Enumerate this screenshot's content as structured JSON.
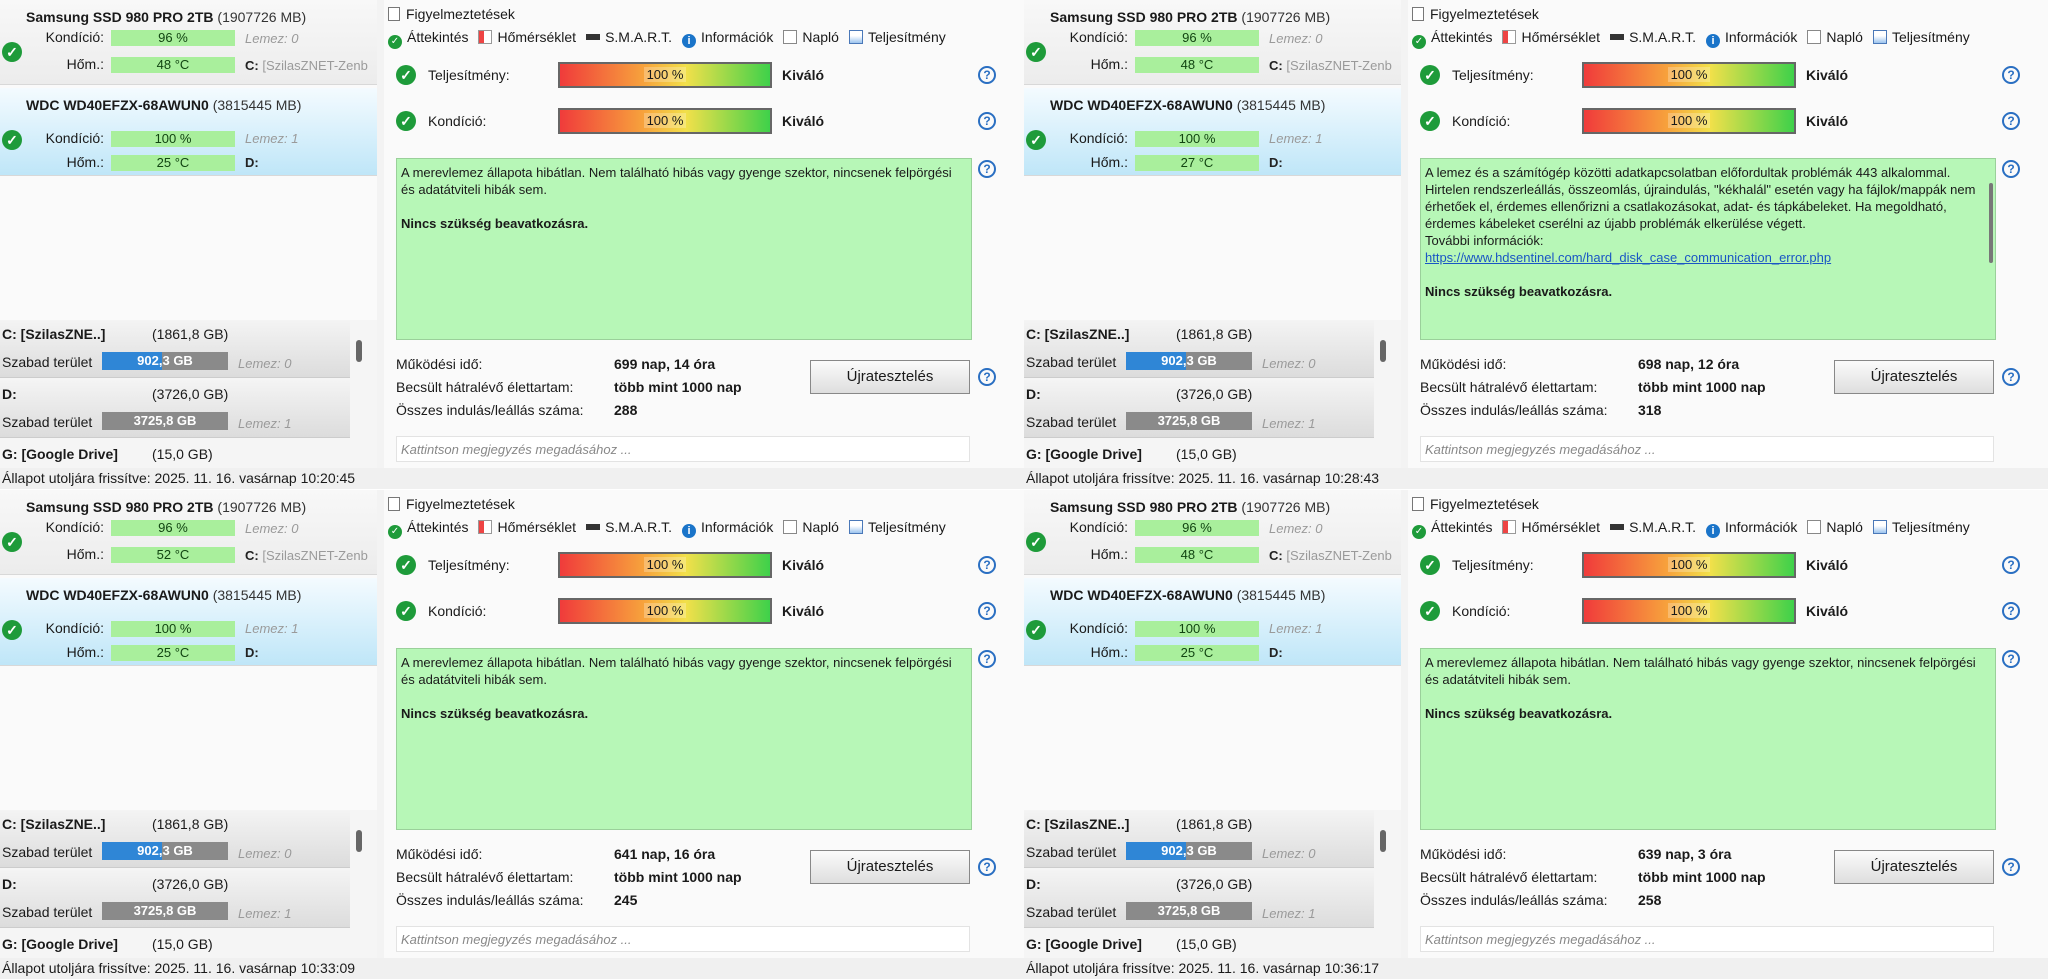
{
  "icon_names": {
    "ok": "check-circle-icon",
    "temp": "thermometer-icon",
    "smart": "smart-icon",
    "info": "info-icon",
    "log": "log-icon",
    "perf": "performance-chart-icon",
    "help": "help-icon",
    "warn": "document-icon"
  },
  "colors": {
    "health_bar": "#a9ef9c",
    "selected_disk": "#bfe6f8",
    "message_bg": "#b7f7b7",
    "free_bar": "#2f86d6",
    "ok": "#1e9b3a"
  },
  "panes": [
    {
      "disks": [
        {
          "name": "Samsung SSD 980 PRO 2TB",
          "size": "(1907726 MB)",
          "health_label": "Kondíció:",
          "health": "96 %",
          "temp_label": "Hőm.:",
          "temp": "48 °C",
          "lemez": "Lemez: 0",
          "drive_letter": "C:",
          "drive_name": "[SzilasZNET-Zenb"
        },
        {
          "name": "WDC WD40EFZX-68AWUN0",
          "size": "(3815445 MB)",
          "health_label": "Kondíció:",
          "health": "100 %",
          "temp_label": "Hőm.:",
          "temp": "25 °C",
          "lemez": "Lemez: 1",
          "drive_letter": "D:",
          "drive_name": ""
        }
      ],
      "volumes": [
        {
          "title": "C: [SzilasZNE..]",
          "size": "(1861,8 GB)",
          "free_label": "Szabad terület",
          "free": "902,3 GB",
          "free_fraction": 0.48,
          "lemez": "Lemez: 0"
        },
        {
          "title": "D:",
          "size": "(3726,0 GB)",
          "free_label": "Szabad terület",
          "free": "3725,8 GB",
          "free_fraction": 0.0,
          "lemez": "Lemez: 1"
        },
        {
          "title": "G: [Google Drive]",
          "size": "(15,0 GB)"
        }
      ],
      "warnings": "Figyelmeztetések",
      "tabs": [
        "Áttekintés",
        "Hőmérséklet",
        "S.M.A.R.T.",
        "Információk",
        "Napló",
        "Teljesítmény"
      ],
      "perf_label": "Teljesítmény:",
      "perf_value": "100 %",
      "perf_rating": "Kiváló",
      "health_label": "Kondíció:",
      "health_value": "100 %",
      "health_rating": "Kiváló",
      "message_lines": [
        "A merevlemez állapota hibátlan. Nem található hibás vagy gyenge szektor, nincsenek felpörgési és adatátviteli hibák sem."
      ],
      "message_link": "",
      "message_bold": "Nincs szükség beavatkozásra.",
      "uptime_label": "Működési idő:",
      "uptime": "699 nap, 14 óra",
      "life_label": "Becsült hátralévő élettartam:",
      "life": "több mint 1000 nap",
      "starts_label": "Összes indulás/leállás száma:",
      "starts": "288",
      "retest": "Újratesztelés",
      "note_placeholder": "Kattintson megjegyzés megadásához ...",
      "status": "Állapot utoljára frissítve: 2025. 11. 16. vasárnap 10:20:45"
    },
    {
      "disks": [
        {
          "name": "Samsung SSD 980 PRO 2TB",
          "size": "(1907726 MB)",
          "health_label": "Kondíció:",
          "health": "96 %",
          "temp_label": "Hőm.:",
          "temp": "48 °C",
          "lemez": "Lemez: 0",
          "drive_letter": "C:",
          "drive_name": "[SzilasZNET-Zenb"
        },
        {
          "name": "WDC WD40EFZX-68AWUN0",
          "size": "(3815445 MB)",
          "health_label": "Kondíció:",
          "health": "100 %",
          "temp_label": "Hőm.:",
          "temp": "27 °C",
          "lemez": "Lemez: 1",
          "drive_letter": "D:",
          "drive_name": ""
        }
      ],
      "volumes": [
        {
          "title": "C: [SzilasZNE..]",
          "size": "(1861,8 GB)",
          "free_label": "Szabad terület",
          "free": "902,3 GB",
          "free_fraction": 0.48,
          "lemez": "Lemez: 0"
        },
        {
          "title": "D:",
          "size": "(3726,0 GB)",
          "free_label": "Szabad terület",
          "free": "3725,8 GB",
          "free_fraction": 0.0,
          "lemez": "Lemez: 1"
        },
        {
          "title": "G: [Google Drive]",
          "size": "(15,0 GB)"
        }
      ],
      "warnings": "Figyelmeztetések",
      "tabs": [
        "Áttekintés",
        "Hőmérséklet",
        "S.M.A.R.T.",
        "Információk",
        "Napló",
        "Teljesítmény"
      ],
      "perf_label": "Teljesítmény:",
      "perf_value": "100 %",
      "perf_rating": "Kiváló",
      "health_label": "Kondíció:",
      "health_value": "100 %",
      "health_rating": "Kiváló",
      "message_lines": [
        "A lemez és a számítógép közötti adatkapcsolatban előfordultak problémák 443 alkalommal.",
        "Hirtelen rendszerleállás, összeomlás, újraindulás, \"kékhalál\" esetén vagy ha fájlok/mappák nem érhetőek el, érdemes ellenőrizni a csatlakozásokat, adat- és tápkábeleket. Ha megoldható, érdemes kábeleket cserélni az újabb problémák elkerülése végett.",
        "További információk:"
      ],
      "message_link": "https://www.hdsentinel.com/hard_disk_case_communication_error.php",
      "message_bold": "Nincs szükség beavatkozásra.",
      "uptime_label": "Működési idő:",
      "uptime": "698 nap, 12 óra",
      "life_label": "Becsült hátralévő élettartam:",
      "life": "több mint 1000 nap",
      "starts_label": "Összes indulás/leállás száma:",
      "starts": "318",
      "retest": "Újratesztelés",
      "note_placeholder": "Kattintson megjegyzés megadásához ...",
      "status": "Állapot utoljára frissítve: 2025. 11. 16. vasárnap 10:28:43"
    },
    {
      "disks": [
        {
          "name": "Samsung SSD 980 PRO 2TB",
          "size": "(1907726 MB)",
          "health_label": "Kondíció:",
          "health": "96 %",
          "temp_label": "Hőm.:",
          "temp": "52 °C",
          "lemez": "Lemez: 0",
          "drive_letter": "C:",
          "drive_name": "[SzilasZNET-Zenb"
        },
        {
          "name": "WDC WD40EFZX-68AWUN0",
          "size": "(3815445 MB)",
          "health_label": "Kondíció:",
          "health": "100 %",
          "temp_label": "Hőm.:",
          "temp": "25 °C",
          "lemez": "Lemez: 1",
          "drive_letter": "D:",
          "drive_name": ""
        }
      ],
      "volumes": [
        {
          "title": "C: [SzilasZNE..]",
          "size": "(1861,8 GB)",
          "free_label": "Szabad terület",
          "free": "902,3 GB",
          "free_fraction": 0.48,
          "lemez": "Lemez: 0"
        },
        {
          "title": "D:",
          "size": "(3726,0 GB)",
          "free_label": "Szabad terület",
          "free": "3725,8 GB",
          "free_fraction": 0.0,
          "lemez": "Lemez: 1"
        },
        {
          "title": "G: [Google Drive]",
          "size": "(15,0 GB)"
        }
      ],
      "warnings": "Figyelmeztetések",
      "tabs": [
        "Áttekintés",
        "Hőmérséklet",
        "S.M.A.R.T.",
        "Információk",
        "Napló",
        "Teljesítmény"
      ],
      "perf_label": "Teljesítmény:",
      "perf_value": "100 %",
      "perf_rating": "Kiváló",
      "health_label": "Kondíció:",
      "health_value": "100 %",
      "health_rating": "Kiváló",
      "message_lines": [
        "A merevlemez állapota hibátlan. Nem található hibás vagy gyenge szektor, nincsenek felpörgési és adatátviteli hibák sem."
      ],
      "message_link": "",
      "message_bold": "Nincs szükség beavatkozásra.",
      "uptime_label": "Működési idő:",
      "uptime": "641 nap, 16 óra",
      "life_label": "Becsült hátralévő élettartam:",
      "life": "több mint 1000 nap",
      "starts_label": "Összes indulás/leállás száma:",
      "starts": "245",
      "retest": "Újratesztelés",
      "note_placeholder": "Kattintson megjegyzés megadásához ...",
      "status": "Állapot utoljára frissítve: 2025. 11. 16. vasárnap 10:33:09"
    },
    {
      "disks": [
        {
          "name": "Samsung SSD 980 PRO 2TB",
          "size": "(1907726 MB)",
          "health_label": "Kondíció:",
          "health": "96 %",
          "temp_label": "Hőm.:",
          "temp": "48 °C",
          "lemez": "Lemez: 0",
          "drive_letter": "C:",
          "drive_name": "[SzilasZNET-Zenb"
        },
        {
          "name": "WDC WD40EFZX-68AWUN0",
          "size": "(3815445 MB)",
          "health_label": "Kondíció:",
          "health": "100 %",
          "temp_label": "Hőm.:",
          "temp": "25 °C",
          "lemez": "Lemez: 1",
          "drive_letter": "D:",
          "drive_name": ""
        }
      ],
      "volumes": [
        {
          "title": "C: [SzilasZNE..]",
          "size": "(1861,8 GB)",
          "free_label": "Szabad terület",
          "free": "902,3 GB",
          "free_fraction": 0.48,
          "lemez": "Lemez: 0"
        },
        {
          "title": "D:",
          "size": "(3726,0 GB)",
          "free_label": "Szabad terület",
          "free": "3725,8 GB",
          "free_fraction": 0.0,
          "lemez": "Lemez: 1"
        },
        {
          "title": "G: [Google Drive]",
          "size": "(15,0 GB)"
        }
      ],
      "warnings": "Figyelmeztetések",
      "tabs": [
        "Áttekintés",
        "Hőmérséklet",
        "S.M.A.R.T.",
        "Információk",
        "Napló",
        "Teljesítmény"
      ],
      "perf_label": "Teljesítmény:",
      "perf_value": "100 %",
      "perf_rating": "Kiváló",
      "health_label": "Kondíció:",
      "health_value": "100 %",
      "health_rating": "Kiváló",
      "message_lines": [
        "A merevlemez állapota hibátlan. Nem található hibás vagy gyenge szektor, nincsenek felpörgési és adatátviteli hibák sem."
      ],
      "message_link": "",
      "message_bold": "Nincs szükség beavatkozásra.",
      "uptime_label": "Működési idő:",
      "uptime": "639 nap, 3 óra",
      "life_label": "Becsült hátralévő élettartam:",
      "life": "több mint 1000 nap",
      "starts_label": "Összes indulás/leállás száma:",
      "starts": "258",
      "retest": "Újratesztelés",
      "note_placeholder": "Kattintson megjegyzés megadásához ...",
      "status": "Állapot utoljára frissítve: 2025. 11. 16. vasárnap 10:36:17"
    }
  ]
}
